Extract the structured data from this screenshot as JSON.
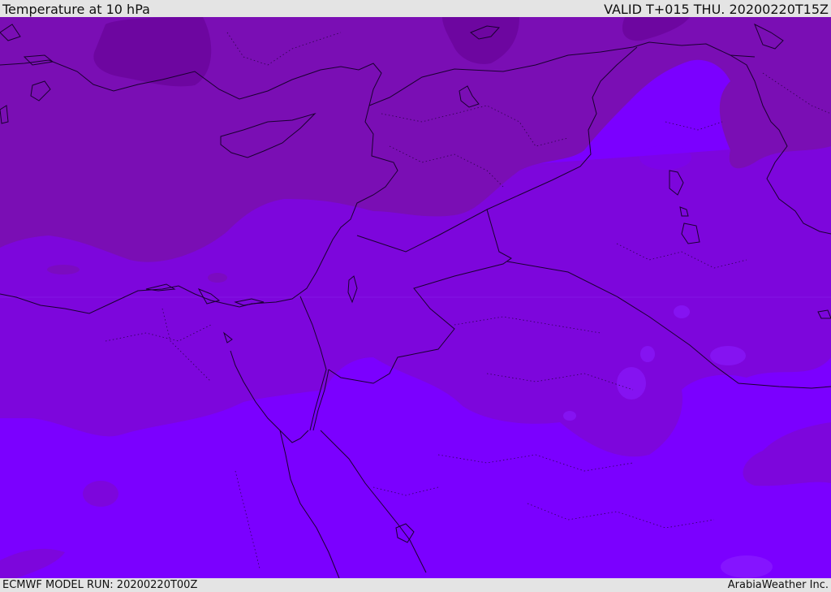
{
  "header": {
    "title": "Temperature at 10 hPa",
    "valid": "VALID T+015 THU. 20200220T15Z"
  },
  "footer": {
    "model_run": "ECMWF MODEL RUN: 20200220T00Z",
    "credit": "ArabiaWeather Inc."
  },
  "map": {
    "colors": {
      "darkest": "#6d06a0",
      "dark": "#7a0eb4",
      "mid": "#7d06dc",
      "light": "#7b00ff",
      "lightest": "#8a1dff",
      "coast": "#1a0030"
    }
  }
}
